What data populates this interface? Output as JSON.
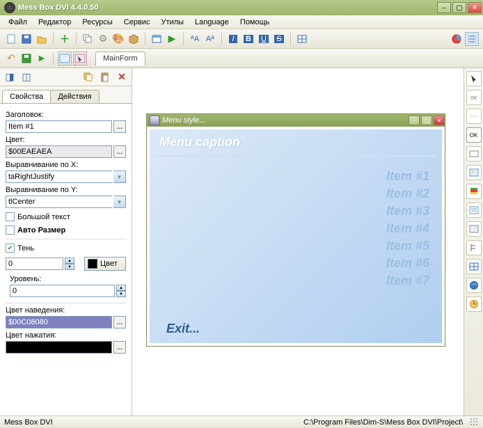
{
  "title": "Mess Box DVI 4.4.0.50",
  "menus": [
    "Файл",
    "Редактор",
    "Ресурсы",
    "Сервис",
    "Утилы",
    "Language",
    "Помощь"
  ],
  "doc_tab": "MainForm",
  "prop_tabs": {
    "props": "Свойства",
    "actions": "Действия"
  },
  "labels": {
    "header": "Заголовок:",
    "color": "Цвет:",
    "align_x": "Выравнивание по Х:",
    "align_y": "Выравнивание  по Y:",
    "bigtext": "Большой текст",
    "autosize": "Авто Размер",
    "shadow": "Тень",
    "level": "Уровень:",
    "hover_color": "Цвет наведения:",
    "press_color": "Цвет нажатия:",
    "color_btn": "Цвет"
  },
  "values": {
    "header": "Item #1",
    "color": "$00EAEAEA",
    "align_x": "taRightJustify",
    "align_y": "tlCenter",
    "shadow_num": "0",
    "level_num": "0",
    "hover_color": "$00C08080"
  },
  "designer": {
    "window_title": "Menu style...",
    "menu_caption": "Menu caption",
    "menu_items": [
      "Item #1",
      "Item #2",
      "Item #3",
      "Item #4",
      "Item #5",
      "Item #6",
      "Item #7"
    ],
    "exit": "Exit..."
  },
  "status": {
    "left": "Mess Box DVI",
    "right": "C:\\Program Files\\Dim-S\\Mess Box DVI\\Project\\"
  }
}
